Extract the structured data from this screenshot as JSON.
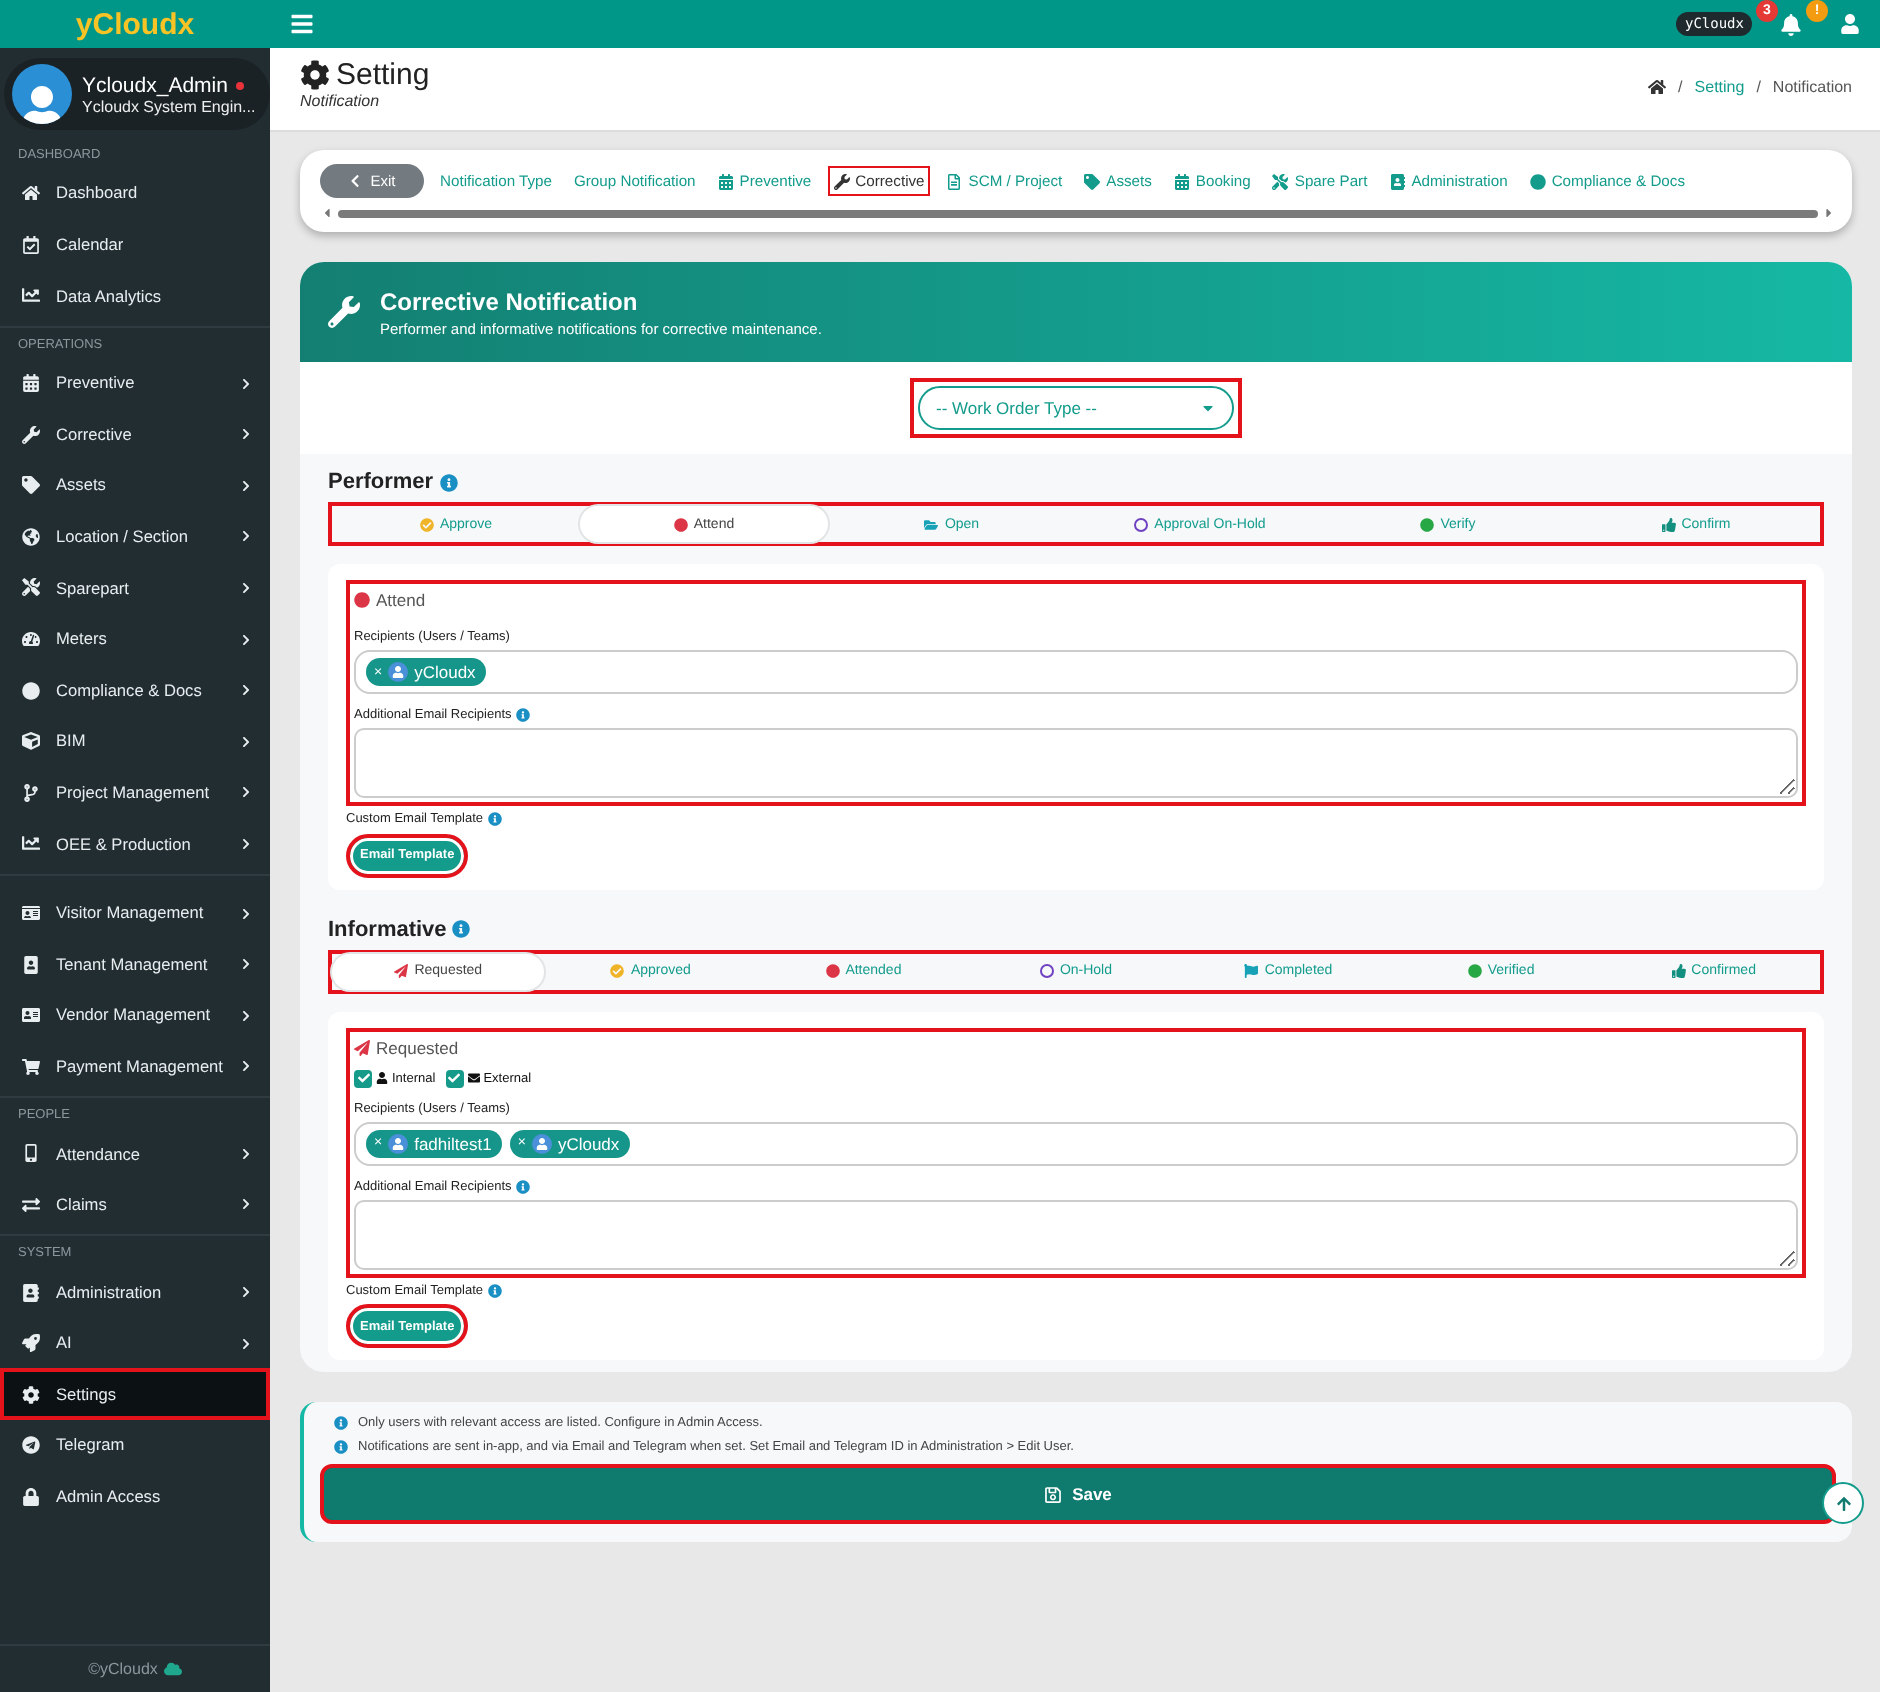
{
  "topbar": {
    "logo": "yCloudx",
    "user_tag": "yCloudx",
    "bell_count": "3",
    "alert_badge": "!"
  },
  "user": {
    "name": "Ycloudx_Admin",
    "role": "Ycloudx System Engin...",
    "online": true
  },
  "sidebar": {
    "sections": [
      {
        "label": "DASHBOARD",
        "items": [
          {
            "label": "Dashboard",
            "submenu": false,
            "selected": false,
            "highlighted": false
          },
          {
            "label": "Calendar",
            "submenu": false,
            "selected": false,
            "highlighted": false
          },
          {
            "label": "Data Analytics",
            "submenu": false,
            "selected": false,
            "highlighted": false
          }
        ]
      },
      {
        "label": "OPERATIONS",
        "items": [
          {
            "label": "Preventive",
            "submenu": true,
            "selected": false,
            "highlighted": false
          },
          {
            "label": "Corrective",
            "submenu": true,
            "selected": false,
            "highlighted": false
          },
          {
            "label": "Assets",
            "submenu": true,
            "selected": false,
            "highlighted": false
          },
          {
            "label": "Location / Section",
            "submenu": true,
            "selected": false,
            "highlighted": false
          },
          {
            "label": "Sparepart",
            "submenu": true,
            "selected": false,
            "highlighted": false
          },
          {
            "label": "Meters",
            "submenu": true,
            "selected": false,
            "highlighted": false
          },
          {
            "label": "Compliance & Docs",
            "submenu": true,
            "selected": false,
            "highlighted": false
          },
          {
            "label": "BIM",
            "submenu": true,
            "selected": false,
            "highlighted": false
          },
          {
            "label": "Project Management",
            "submenu": true,
            "selected": false,
            "highlighted": false
          },
          {
            "label": "OEE & Production",
            "submenu": true,
            "selected": false,
            "highlighted": false
          }
        ]
      },
      {
        "items": [
          {
            "label": "Visitor Management",
            "submenu": true,
            "selected": false,
            "highlighted": false
          },
          {
            "label": "Tenant Management",
            "submenu": true,
            "selected": false,
            "highlighted": false
          },
          {
            "label": "Vendor Management",
            "submenu": true,
            "selected": false,
            "highlighted": false
          },
          {
            "label": "Payment Management",
            "submenu": true,
            "selected": false,
            "highlighted": false
          }
        ]
      },
      {
        "label": "PEOPLE",
        "items": [
          {
            "label": "Attendance",
            "submenu": true,
            "selected": false,
            "highlighted": false
          },
          {
            "label": "Claims",
            "submenu": true,
            "selected": false,
            "highlighted": false
          }
        ]
      },
      {
        "label": "SYSTEM",
        "items": [
          {
            "label": "Administration",
            "submenu": true,
            "selected": false,
            "highlighted": false
          },
          {
            "label": "AI",
            "submenu": true,
            "selected": false,
            "highlighted": false
          },
          {
            "label": "Settings",
            "submenu": false,
            "selected": true,
            "highlighted": true
          },
          {
            "label": "Telegram",
            "submenu": false,
            "selected": false,
            "highlighted": false
          },
          {
            "label": "Admin Access",
            "submenu": false,
            "selected": false,
            "highlighted": false
          }
        ]
      }
    ],
    "footer": "©yCloudx"
  },
  "page_header": {
    "title": "Setting",
    "subtitle": "Notification",
    "breadcrumb": [
      {
        "kind": "home"
      },
      {
        "kind": "separator",
        "label": "/"
      },
      {
        "kind": "link",
        "label": "Setting"
      },
      {
        "kind": "separator",
        "label": "/"
      },
      {
        "kind": "current",
        "label": "Notification"
      }
    ]
  },
  "nav": {
    "exit": "Exit",
    "tabs": [
      {
        "label": "Notification Type",
        "selected": false,
        "highlighted": false
      },
      {
        "label": "Group Notification",
        "selected": false,
        "highlighted": false
      },
      {
        "label": "Preventive",
        "selected": false,
        "highlighted": false
      },
      {
        "label": "Corrective",
        "selected": true,
        "highlighted": true
      },
      {
        "label": "SCM / Project",
        "selected": false,
        "highlighted": false
      },
      {
        "label": "Assets",
        "selected": false,
        "highlighted": false
      },
      {
        "label": "Booking",
        "selected": false,
        "highlighted": false
      },
      {
        "label": "Spare Part",
        "selected": false,
        "highlighted": false
      },
      {
        "label": "Administration",
        "selected": false,
        "highlighted": false
      },
      {
        "label": "Compliance & Docs",
        "selected": false,
        "highlighted": false
      }
    ]
  },
  "card": {
    "title": "Corrective Notification",
    "subtitle": "Performer and informative notifications for corrective maintenance.",
    "select": {
      "placeholder": "-- Work Order Type --",
      "highlighted": true
    }
  },
  "sections": [
    {
      "kind": "performer",
      "heading": "Performer",
      "tabs_highlighted": true,
      "tabs": [
        {
          "label": "Approve",
          "color": "#f0b429",
          "selected": false
        },
        {
          "label": "Attend",
          "color": "#dc3545",
          "selected": true
        },
        {
          "label": "Open",
          "color": "#17a2b8",
          "selected": false
        },
        {
          "label": "Approval On-Hold",
          "color": "#6f42c1",
          "selected": false
        },
        {
          "label": "Verify",
          "color": "#28a745",
          "selected": false
        },
        {
          "label": "Confirm",
          "color": "#128f7e",
          "selected": false
        }
      ],
      "panel": {
        "title": "Attend",
        "highlighted": true,
        "remove_label": "×",
        "recipients_label": "Recipients (Users / Teams)",
        "recipients": [
          "yCloudx"
        ],
        "additional_label": "Additional Email Recipients",
        "template_label": "Custom Email Template",
        "template_button": "Email Template",
        "template_highlighted": true
      }
    },
    {
      "kind": "informative",
      "heading": "Informative",
      "tabs_highlighted": true,
      "tabs": [
        {
          "label": "Requested",
          "color": "#dc3545",
          "selected": true
        },
        {
          "label": "Approved",
          "color": "#f0b429",
          "selected": false
        },
        {
          "label": "Attended",
          "color": "#dc3545",
          "selected": false
        },
        {
          "label": "On-Hold",
          "color": "#6f42c1",
          "selected": false
        },
        {
          "label": "Completed",
          "color": "#17a2b8",
          "selected": false
        },
        {
          "label": "Verified",
          "color": "#28a745",
          "selected": false
        },
        {
          "label": "Confirmed",
          "color": "#128f7e",
          "selected": false
        }
      ],
      "panel": {
        "title": "Requested",
        "highlighted": true,
        "remove_label": "×",
        "checkboxes": [
          {
            "label": "Internal",
            "checked": true
          },
          {
            "label": "External",
            "checked": true
          }
        ],
        "recipients_label": "Recipients (Users / Teams)",
        "recipients": [
          "fadhiltest1",
          "yCloudx"
        ],
        "additional_label": "Additional Email Recipients",
        "template_label": "Custom Email Template",
        "template_button": "Email Template",
        "template_highlighted": true
      }
    }
  ],
  "footer": {
    "notes": [
      "Only users with relevant access are listed. Configure in Admin Access.",
      "Notifications are sent in-app, and via Email and Telegram when set. Set Email and Telegram ID in Administration > Edit User."
    ],
    "save": "Save",
    "save_highlighted": true
  }
}
